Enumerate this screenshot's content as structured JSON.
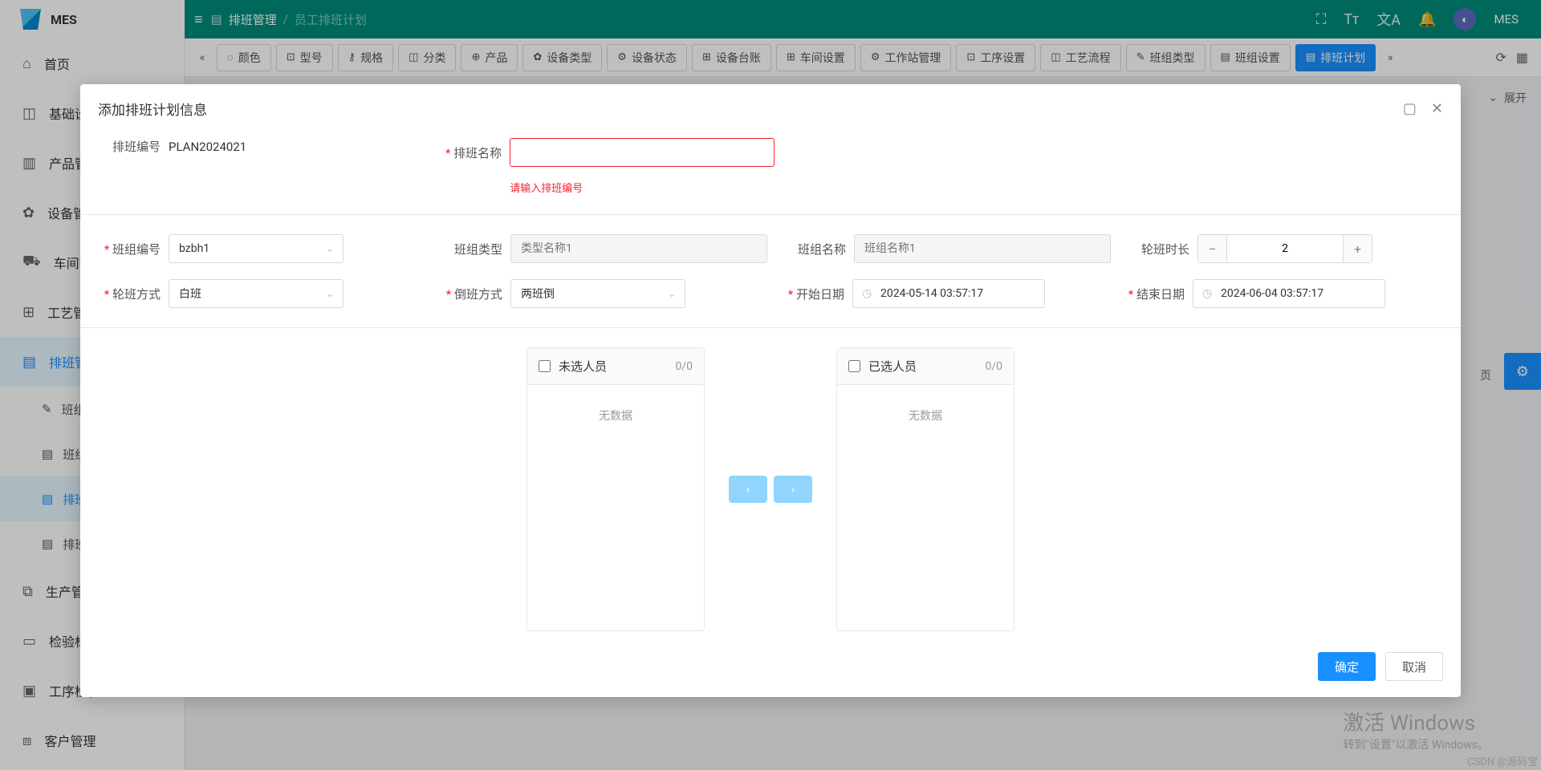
{
  "brand": "MES",
  "header": {
    "breadcrumb_root": "排班管理",
    "breadcrumb_current": "员工排班计划",
    "username": "MES"
  },
  "sidebar": {
    "items": [
      {
        "icon": "⌂",
        "label": "首页"
      },
      {
        "icon": "◫",
        "label": "基础设"
      },
      {
        "icon": "⫾⫾",
        "label": "产品管"
      },
      {
        "icon": "✿",
        "label": "设备管"
      },
      {
        "icon": "⛟",
        "label": "车间管"
      },
      {
        "icon": "⊞",
        "label": "工艺管"
      },
      {
        "icon": "▤",
        "label": "排班管",
        "active": true
      },
      {
        "icon": "⧉",
        "label": "生产管"
      },
      {
        "icon": "▭",
        "label": "检验标"
      },
      {
        "icon": "▣",
        "label": "工序检验",
        "chevron": true
      },
      {
        "icon": "⧈",
        "label": "客户管理"
      }
    ],
    "sub": [
      {
        "icon": "✎",
        "label": "班组"
      },
      {
        "icon": "▤",
        "label": "班组"
      },
      {
        "icon": "▤",
        "label": "排班",
        "active": true
      },
      {
        "icon": "▤",
        "label": "排班"
      }
    ]
  },
  "tabs": {
    "items": [
      {
        "icon": "◌",
        "label": "颜色"
      },
      {
        "icon": "⊡",
        "label": "型号"
      },
      {
        "icon": "⚷",
        "label": "规格"
      },
      {
        "icon": "◫",
        "label": "分类"
      },
      {
        "icon": "⊕",
        "label": "产品"
      },
      {
        "icon": "✿",
        "label": "设备类型"
      },
      {
        "icon": "⚙",
        "label": "设备状态"
      },
      {
        "icon": "⊞",
        "label": "设备台账"
      },
      {
        "icon": "⊞",
        "label": "车间设置"
      },
      {
        "icon": "⚙",
        "label": "工作站管理"
      },
      {
        "icon": "⊡",
        "label": "工序设置"
      },
      {
        "icon": "◫",
        "label": "工艺流程"
      },
      {
        "icon": "✎",
        "label": "班组类型"
      },
      {
        "icon": "▤",
        "label": "班组设置"
      },
      {
        "icon": "▤",
        "label": "排班计划",
        "active": true
      }
    ]
  },
  "content": {
    "expand": "展开",
    "page": "页"
  },
  "dialog": {
    "title": "添加排班计划信息",
    "fields": {
      "plan_no_label": "排班编号",
      "plan_no_value": "PLAN2024021",
      "plan_name_label": "排班名称",
      "plan_name_error": "请输入排班编号",
      "team_no_label": "班组编号",
      "team_no_value": "bzbh1",
      "team_type_label": "班组类型",
      "team_type_placeholder": "类型名称1",
      "team_name_label": "班组名称",
      "team_name_placeholder": "班组名称1",
      "shift_hours_label": "轮班时长",
      "shift_hours_value": "2",
      "shift_method_label": "轮班方式",
      "shift_method_value": "白班",
      "rotation_label": "倒班方式",
      "rotation_value": "两班倒",
      "start_date_label": "开始日期",
      "start_date_value": "2024-05-14 03:57:17",
      "end_date_label": "结束日期",
      "end_date_value": "2024-06-04 03:57:17"
    },
    "transfer": {
      "left_title": "未选人员",
      "left_count": "0/0",
      "right_title": "已选人员",
      "right_count": "0/0",
      "empty": "无数据"
    },
    "buttons": {
      "ok": "确定",
      "cancel": "取消"
    }
  },
  "watermark": {
    "line1": "激活 Windows",
    "line2": "转到\"设置\"以激活 Windows。"
  },
  "csdn": "CSDN @源码宝"
}
